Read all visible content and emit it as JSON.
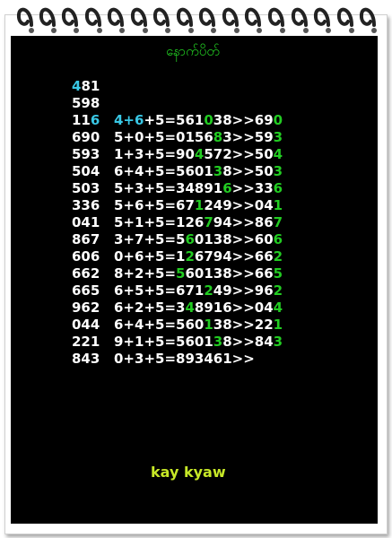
{
  "title": "နောက်ပိတ်",
  "footer": "kay kyaw",
  "colors": {
    "accent_green": "#22cc22",
    "accent_cyan": "#39c8e6",
    "footer_yellow": "#c7e827",
    "board": "#000000"
  },
  "rows": [
    {
      "id": "r1",
      "left": [
        {
          "t": "4",
          "c": "c"
        },
        {
          "t": "81"
        }
      ],
      "right": []
    },
    {
      "id": "r2",
      "left": [
        {
          "t": "598"
        }
      ],
      "right": []
    },
    {
      "id": "r3",
      "left": [
        {
          "t": "11"
        },
        {
          "t": "6",
          "c": "c"
        }
      ],
      "right": [
        {
          "t": "4+6",
          "c": "c"
        },
        {
          "t": "+5=561"
        },
        {
          "t": "0",
          "c": "g"
        },
        {
          "t": "38>>69"
        },
        {
          "t": "0",
          "c": "g"
        }
      ]
    },
    {
      "id": "r4",
      "left": [
        {
          "t": "690"
        }
      ],
      "right": [
        {
          "t": "5+0+5=0156"
        },
        {
          "t": "8",
          "c": "g"
        },
        {
          "t": "3>>59"
        },
        {
          "t": "3",
          "c": "g"
        }
      ]
    },
    {
      "id": "r5",
      "left": [
        {
          "t": "593"
        }
      ],
      "right": [
        {
          "t": "1+3+5=90"
        },
        {
          "t": "4",
          "c": "g"
        },
        {
          "t": "572>>50"
        },
        {
          "t": "4",
          "c": "g"
        }
      ]
    },
    {
      "id": "r6",
      "left": [
        {
          "t": "504"
        }
      ],
      "right": [
        {
          "t": "6+4+5=5601"
        },
        {
          "t": "3",
          "c": "g"
        },
        {
          "t": "8>>50"
        },
        {
          "t": "3",
          "c": "g"
        }
      ]
    },
    {
      "id": "r7",
      "left": [
        {
          "t": "503"
        }
      ],
      "right": [
        {
          "t": "5+3+5=34891"
        },
        {
          "t": "6",
          "c": "g"
        },
        {
          "t": ">>33"
        },
        {
          "t": "6",
          "c": "g"
        }
      ]
    },
    {
      "id": "r8",
      "left": [
        {
          "t": "336"
        }
      ],
      "right": [
        {
          "t": "5+6+5=67"
        },
        {
          "t": "1",
          "c": "g"
        },
        {
          "t": "249>>04"
        },
        {
          "t": "1",
          "c": "g"
        }
      ]
    },
    {
      "id": "r9",
      "left": [
        {
          "t": "041"
        }
      ],
      "right": [
        {
          "t": "5+1+5=126"
        },
        {
          "t": "7",
          "c": "g"
        },
        {
          "t": "94>>86"
        },
        {
          "t": "7",
          "c": "g"
        }
      ]
    },
    {
      "id": "r10",
      "left": [
        {
          "t": "867"
        }
      ],
      "right": [
        {
          "t": "3+7+5=5"
        },
        {
          "t": "6",
          "c": "g"
        },
        {
          "t": "0138>>60"
        },
        {
          "t": "6",
          "c": "g"
        }
      ]
    },
    {
      "id": "r11",
      "left": [
        {
          "t": "606"
        }
      ],
      "right": [
        {
          "t": "0+6+5=1"
        },
        {
          "t": "2",
          "c": "g"
        },
        {
          "t": "6794>>66"
        },
        {
          "t": "2",
          "c": "g"
        }
      ]
    },
    {
      "id": "r12",
      "left": [
        {
          "t": "662"
        }
      ],
      "right": [
        {
          "t": "8+2+5="
        },
        {
          "t": "5",
          "c": "g"
        },
        {
          "t": "60138>>66"
        },
        {
          "t": "5",
          "c": "g"
        }
      ]
    },
    {
      "id": "r13",
      "left": [
        {
          "t": "665"
        }
      ],
      "right": [
        {
          "t": "6+5+5=671"
        },
        {
          "t": "2",
          "c": "g"
        },
        {
          "t": "49>>96"
        },
        {
          "t": "2",
          "c": "g"
        }
      ]
    },
    {
      "id": "r14",
      "left": [
        {
          "t": "962"
        }
      ],
      "right": [
        {
          "t": "6+2+5=3"
        },
        {
          "t": "4",
          "c": "g"
        },
        {
          "t": "8916>>04"
        },
        {
          "t": "4",
          "c": "g"
        }
      ]
    },
    {
      "id": "r15",
      "left": [
        {
          "t": "044"
        }
      ],
      "right": [
        {
          "t": "6+4+5=560"
        },
        {
          "t": "1",
          "c": "g"
        },
        {
          "t": "38>>22"
        },
        {
          "t": "1",
          "c": "g"
        }
      ]
    },
    {
      "id": "r16",
      "left": [
        {
          "t": "221"
        }
      ],
      "right": [
        {
          "t": "9+1+5=5601"
        },
        {
          "t": "3",
          "c": "g"
        },
        {
          "t": "8>>84"
        },
        {
          "t": "3",
          "c": "g"
        }
      ]
    },
    {
      "id": "r17",
      "left": [
        {
          "t": "843"
        }
      ],
      "right": [
        {
          "t": "0+3+5=893461>>"
        }
      ]
    }
  ]
}
